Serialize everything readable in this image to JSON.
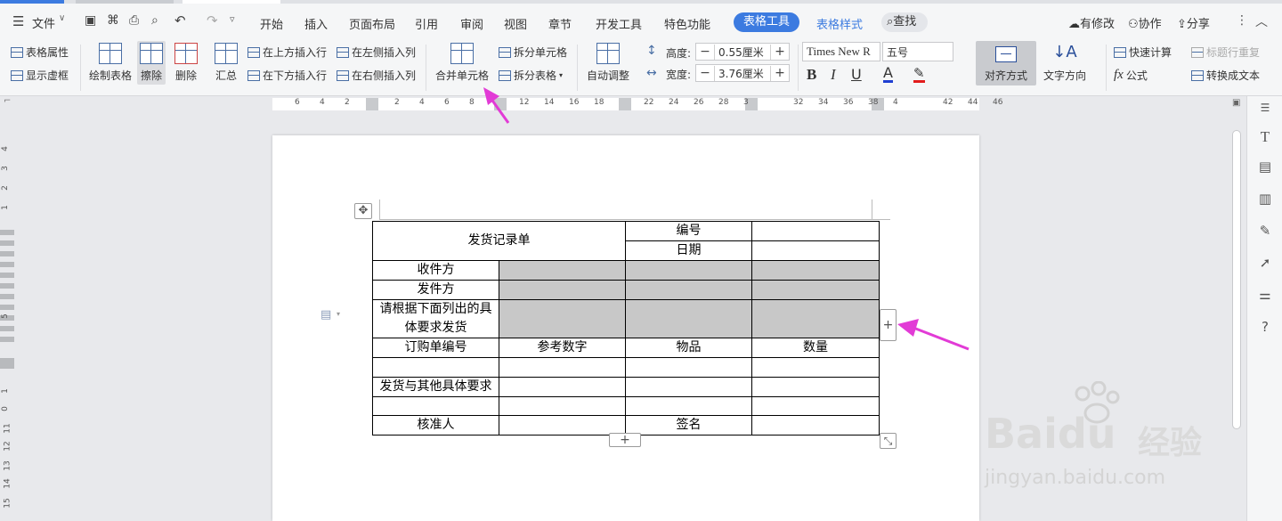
{
  "menubar": {
    "file_label": "文件",
    "tabs": [
      "开始",
      "插入",
      "页面布局",
      "引用",
      "审阅",
      "视图",
      "章节",
      "开发工具",
      "特色功能"
    ],
    "active_tab": "表格工具",
    "style_tab": "表格样式",
    "search_label": "查找",
    "right": {
      "modified": "有修改",
      "collab": "协作",
      "share": "分享"
    }
  },
  "ribbon": {
    "table_props": "表格属性",
    "show_grid": "显示虚框",
    "draw_table": "绘制表格",
    "erase": "擦除",
    "delete": "删除",
    "summary": "汇总",
    "insert_above": "在上方插入行",
    "insert_below": "在下方插入行",
    "insert_left": "在左侧插入列",
    "insert_right": "在右侧插入列",
    "merge_cells": "合并单元格",
    "split_cells": "拆分单元格",
    "split_table": "拆分表格",
    "auto_fit": "自动调整",
    "height_label": "高度:",
    "height_value": "0.55厘米",
    "width_label": "宽度:",
    "width_value": "3.76厘米",
    "font_name": "Times New R",
    "font_size": "五号",
    "bold": "B",
    "italic": "I",
    "underline": "U",
    "font_color": "A",
    "align": "对齐方式",
    "text_dir": "文字方向",
    "quick_calc": "快速计算",
    "formula": "公式",
    "repeat_header": "标题行重复",
    "to_text": "转换成文本"
  },
  "ruler_h": [
    "6",
    "4",
    "2",
    "",
    "2",
    "4",
    "6",
    "8",
    "",
    "12",
    "14",
    "16",
    "18",
    "",
    "22",
    "24",
    "26",
    "28",
    "3",
    "",
    "32",
    "34",
    "36",
    "38",
    "4",
    "",
    "42",
    "44",
    "46"
  ],
  "ruler_v": [
    "4",
    "3",
    "2",
    "1",
    "5",
    "1",
    "0",
    "11",
    "12",
    "13",
    "14",
    "15"
  ],
  "table": {
    "title": "发货记录单",
    "number_label": "编号",
    "date_label": "日期",
    "receiver": "收件方",
    "sender": "发件方",
    "requirement": "请根据下面列出的具体要求发货",
    "order_no": "订购单编号",
    "reference": "参考数字",
    "item": "物品",
    "quantity": "数量",
    "other_req": "发货与其他具体要求",
    "approver": "核准人",
    "signature": "签名"
  },
  "handles": {
    "add_row": "+",
    "add_col": "+"
  },
  "watermark": {
    "brand": "Baidu",
    "cn": "经验",
    "url": "jingyan.baidu.com"
  },
  "colors": {
    "accent": "#3c7be0",
    "arrow": "#e23bd6",
    "gray_cell": "#c8c8c8"
  }
}
